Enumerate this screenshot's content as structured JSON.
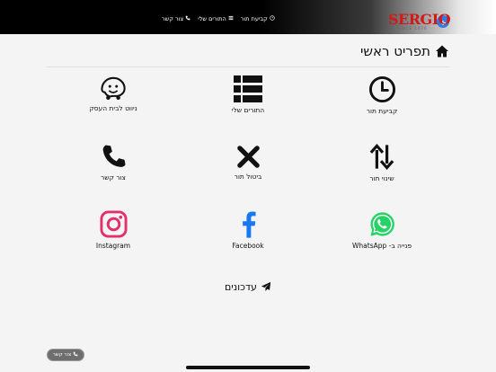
{
  "brand": {
    "logo_text": "SERGIO",
    "logo_sub": "SINCE 1976"
  },
  "nav": [
    {
      "label": "קביעת תור",
      "icon": "clock-icon"
    },
    {
      "label": "התורים שלי",
      "icon": "list-icon"
    },
    {
      "label": "צור קשר",
      "icon": "phone-icon"
    }
  ],
  "page": {
    "title": "תפריט ראשי"
  },
  "tiles": [
    {
      "label": "קביעת תור",
      "icon": "clock-icon"
    },
    {
      "label": "התורים שלי",
      "icon": "list-icon"
    },
    {
      "label": "ניווט לבית העסק",
      "icon": "waze-icon"
    },
    {
      "label": "שינוי תור",
      "icon": "swap-arrows-icon"
    },
    {
      "label": "ביטול תור",
      "icon": "x-icon"
    },
    {
      "label": "צור קשר",
      "icon": "phone-icon"
    },
    {
      "label": "פנייה ב- WhatsApp",
      "icon": "whatsapp-icon"
    },
    {
      "label": "Facebook",
      "icon": "facebook-icon"
    },
    {
      "label": "Instagram",
      "icon": "instagram-icon"
    }
  ],
  "updates": {
    "label": "עדכונים",
    "icon": "paper-plane-icon"
  },
  "floating_contact": {
    "label": "צור קשר",
    "icon": "phone-icon"
  },
  "colors": {
    "whatsapp": "#25d366",
    "facebook": "#1877f2",
    "instagram": "#e1306c",
    "logo_red": "#d41717",
    "lang_button": "#2f7de1"
  }
}
